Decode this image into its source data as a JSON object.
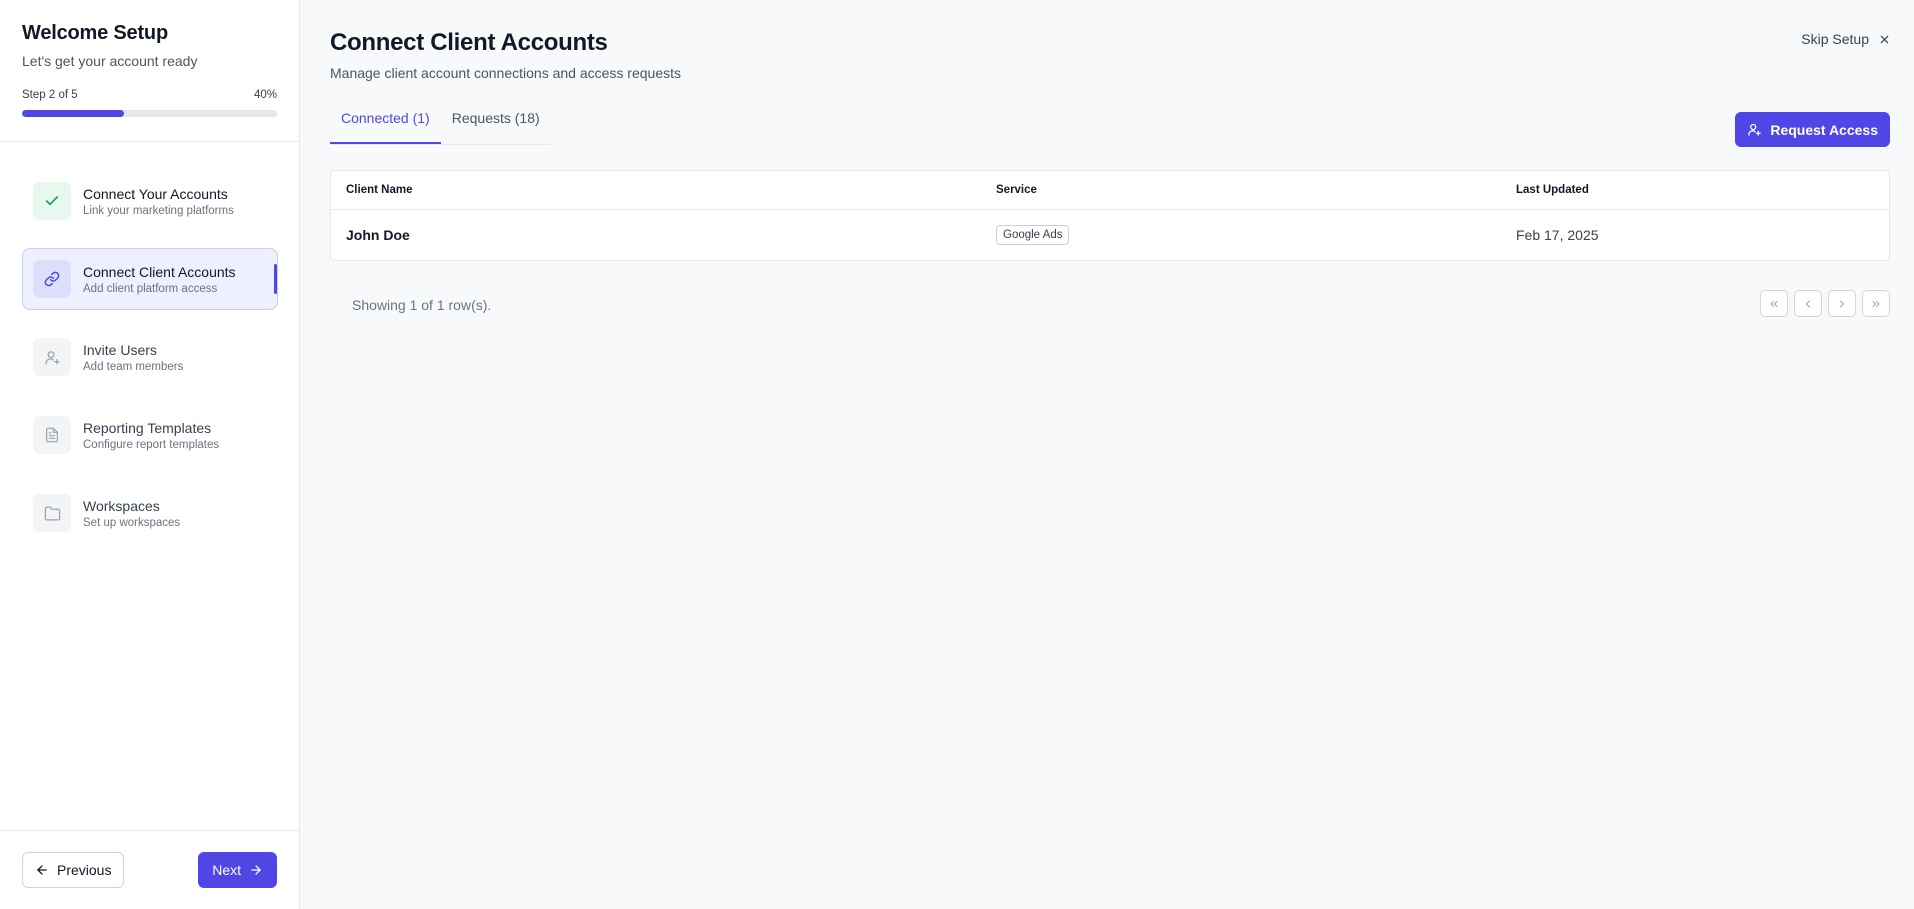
{
  "sidebar": {
    "title": "Welcome Setup",
    "subtitle": "Let's get your account ready",
    "progress": {
      "step_label": "Step 2 of 5",
      "percent_label": "40%",
      "percent": 40
    },
    "steps": [
      {
        "title": "Connect Your Accounts",
        "desc": "Link your marketing platforms",
        "state": "done",
        "icon": "check-icon"
      },
      {
        "title": "Connect Client Accounts",
        "desc": "Add client platform access",
        "state": "current",
        "icon": "link-icon"
      },
      {
        "title": "Invite Users",
        "desc": "Add team members",
        "state": "pending",
        "icon": "user-plus-icon"
      },
      {
        "title": "Reporting Templates",
        "desc": "Configure report templates",
        "state": "pending",
        "icon": "document-icon"
      },
      {
        "title": "Workspaces",
        "desc": "Set up workspaces",
        "state": "pending",
        "icon": "folder-icon"
      }
    ],
    "footer": {
      "prev_label": "Previous",
      "next_label": "Next"
    }
  },
  "main": {
    "title": "Connect Client Accounts",
    "subtitle": "Manage client account connections and access requests",
    "skip_label": "Skip Setup",
    "tabs": [
      {
        "label": "Connected (1)",
        "active": true
      },
      {
        "label": "Requests (18)",
        "active": false
      }
    ],
    "request_access_label": "Request Access",
    "table": {
      "columns": [
        "Client Name",
        "Service",
        "Last Updated"
      ],
      "rows": [
        {
          "client": "John Doe",
          "service": "Google Ads",
          "updated": "Feb 17, 2025"
        }
      ]
    },
    "showing_label": "Showing 1 of 1 row(s)."
  },
  "colors": {
    "accent": "#4f46e5",
    "success": "#16a34a"
  }
}
